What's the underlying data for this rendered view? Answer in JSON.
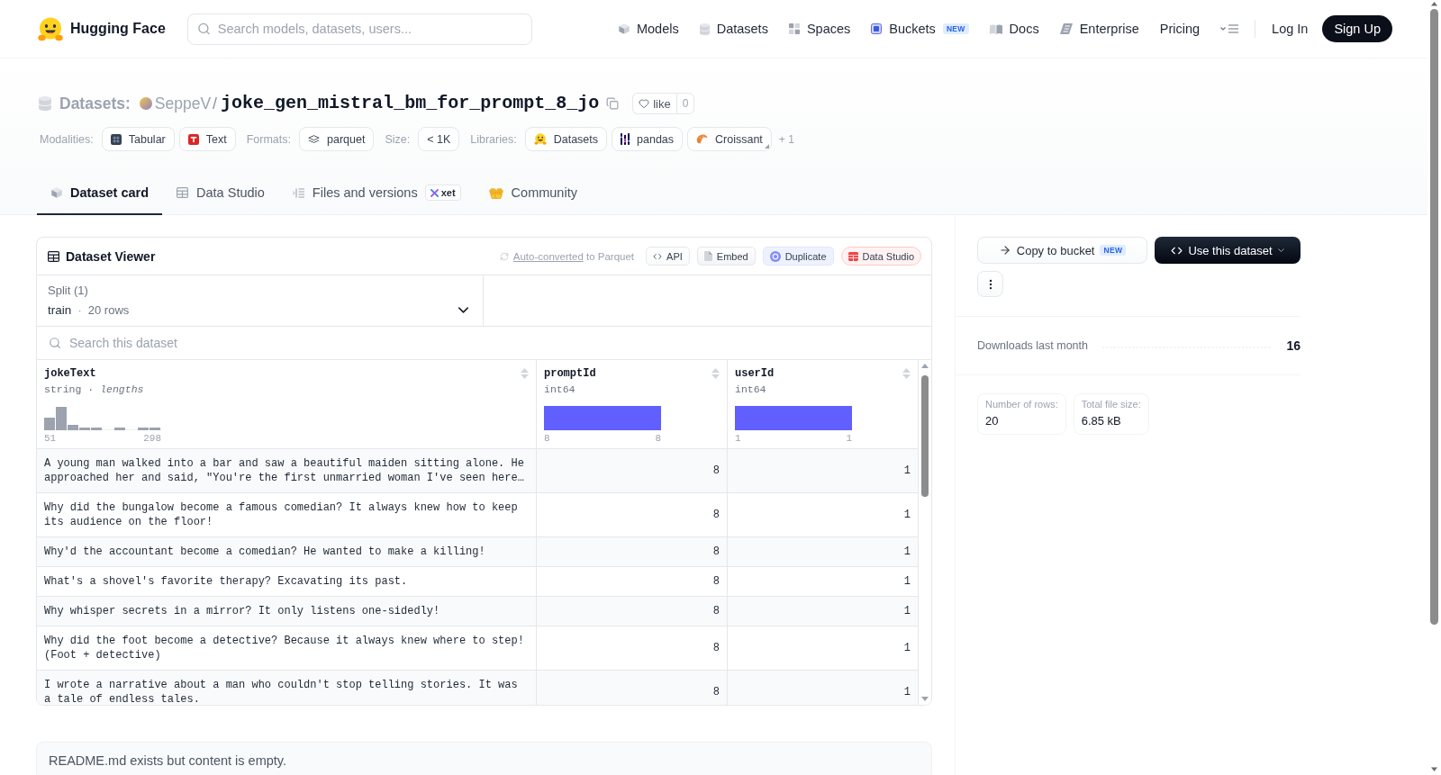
{
  "header": {
    "brand": "Hugging Face",
    "search": {
      "placeholder": "Search models, datasets, users..."
    },
    "nav": [
      {
        "label": "Models",
        "kind": "models"
      },
      {
        "label": "Datasets",
        "kind": "datasets"
      },
      {
        "label": "Spaces",
        "kind": "spaces"
      },
      {
        "label": "Buckets",
        "kind": "buckets",
        "badge": "NEW"
      },
      {
        "label": "Docs",
        "kind": "docs"
      },
      {
        "label": "Enterprise",
        "kind": "enterprise"
      },
      {
        "label": "Pricing",
        "kind": "plain"
      }
    ],
    "login": "Log In",
    "signup": "Sign Up"
  },
  "repo": {
    "type_label": "Datasets:",
    "owner": "SeppeV",
    "separator": "/",
    "name": "joke_gen_mistral_bm_for_prompt_8_jo",
    "like": {
      "label": "like",
      "count": "0"
    }
  },
  "tag_groups": [
    {
      "label": "Modalities:",
      "tags": [
        {
          "label": "Tabular",
          "kind": "tabular"
        },
        {
          "label": "Text",
          "kind": "text"
        }
      ]
    },
    {
      "label": "Formats:",
      "tags": [
        {
          "label": "parquet",
          "kind": "parquet"
        }
      ]
    },
    {
      "label": "Size:",
      "tags": [
        {
          "label": "< 1K",
          "kind": "plain"
        }
      ]
    },
    {
      "label": "Libraries:",
      "tags": [
        {
          "label": "Datasets",
          "kind": "hf"
        },
        {
          "label": "pandas",
          "kind": "pandas"
        },
        {
          "label": "Croissant",
          "kind": "croissant"
        }
      ],
      "more": "+ 1"
    }
  ],
  "tabs": [
    {
      "label": "Dataset card",
      "kind": "card",
      "selected": true
    },
    {
      "label": "Data Studio",
      "kind": "studio",
      "selected": false
    },
    {
      "label": "Files and versions",
      "kind": "files",
      "badge": "xet",
      "selected": false
    },
    {
      "label": "Community",
      "kind": "community",
      "selected": false
    }
  ],
  "viewer": {
    "title": "Dataset Viewer",
    "conversion": {
      "link": "Auto-converted",
      "text": "to Parquet"
    },
    "actions": [
      {
        "label": "API",
        "kind": "api"
      },
      {
        "label": "Embed",
        "kind": "embed"
      },
      {
        "label": "Duplicate",
        "kind": "duplicate"
      },
      {
        "label": "Data Studio",
        "kind": "studio"
      }
    ],
    "split": {
      "label": "Split (1)",
      "value": "train",
      "separator": "·",
      "rows": "20 rows"
    },
    "search": {
      "placeholder": "Search this dataset"
    },
    "columns": [
      {
        "name": "jokeText",
        "type": "string · *lengths*",
        "kind": "histogram",
        "min": "51",
        "max": "298"
      },
      {
        "name": "promptId",
        "type": "int64",
        "kind": "single",
        "min": "8",
        "max": "8"
      },
      {
        "name": "userId",
        "type": "int64",
        "kind": "single",
        "min": "1",
        "max": "1"
      }
    ],
    "rows": [
      {
        "cells": [
          "A young man walked into a bar and saw a beautiful maiden sitting alone. He approached her and said, \"You're the first unmarried woman I've seen here…",
          "8",
          "1"
        ]
      },
      {
        "cells": [
          "Why did the bungalow become a famous comedian? It always knew how to keep its audience on the floor!",
          "8",
          "1"
        ]
      },
      {
        "cells": [
          "Why'd the accountant become a comedian? He wanted to make a killing!",
          "8",
          "1"
        ]
      },
      {
        "cells": [
          "What's a shovel's favorite therapy? Excavating its past.",
          "8",
          "1"
        ]
      },
      {
        "cells": [
          "Why whisper secrets in a mirror? It only listens one-sidedly!",
          "8",
          "1"
        ]
      },
      {
        "cells": [
          "Why did the foot become a detective? Because it always knew where to step! (Foot + detective)",
          "8",
          "1"
        ]
      },
      {
        "cells": [
          "I wrote a narrative about a man who couldn't stop telling stories. It was a tale of endless tales.",
          "8",
          "1"
        ]
      }
    ]
  },
  "readme": {
    "message": "README.md exists but content is empty."
  },
  "sidebar": {
    "copy_button": {
      "label": "Copy to bucket",
      "badge": "NEW"
    },
    "use_button": {
      "label": "Use this dataset"
    },
    "downloads": {
      "label": "Downloads last month",
      "value": "16"
    },
    "stats": [
      {
        "label": "Number of rows:",
        "value": "20"
      },
      {
        "label": "Total file size:",
        "value": "6.85 kB"
      }
    ]
  }
}
